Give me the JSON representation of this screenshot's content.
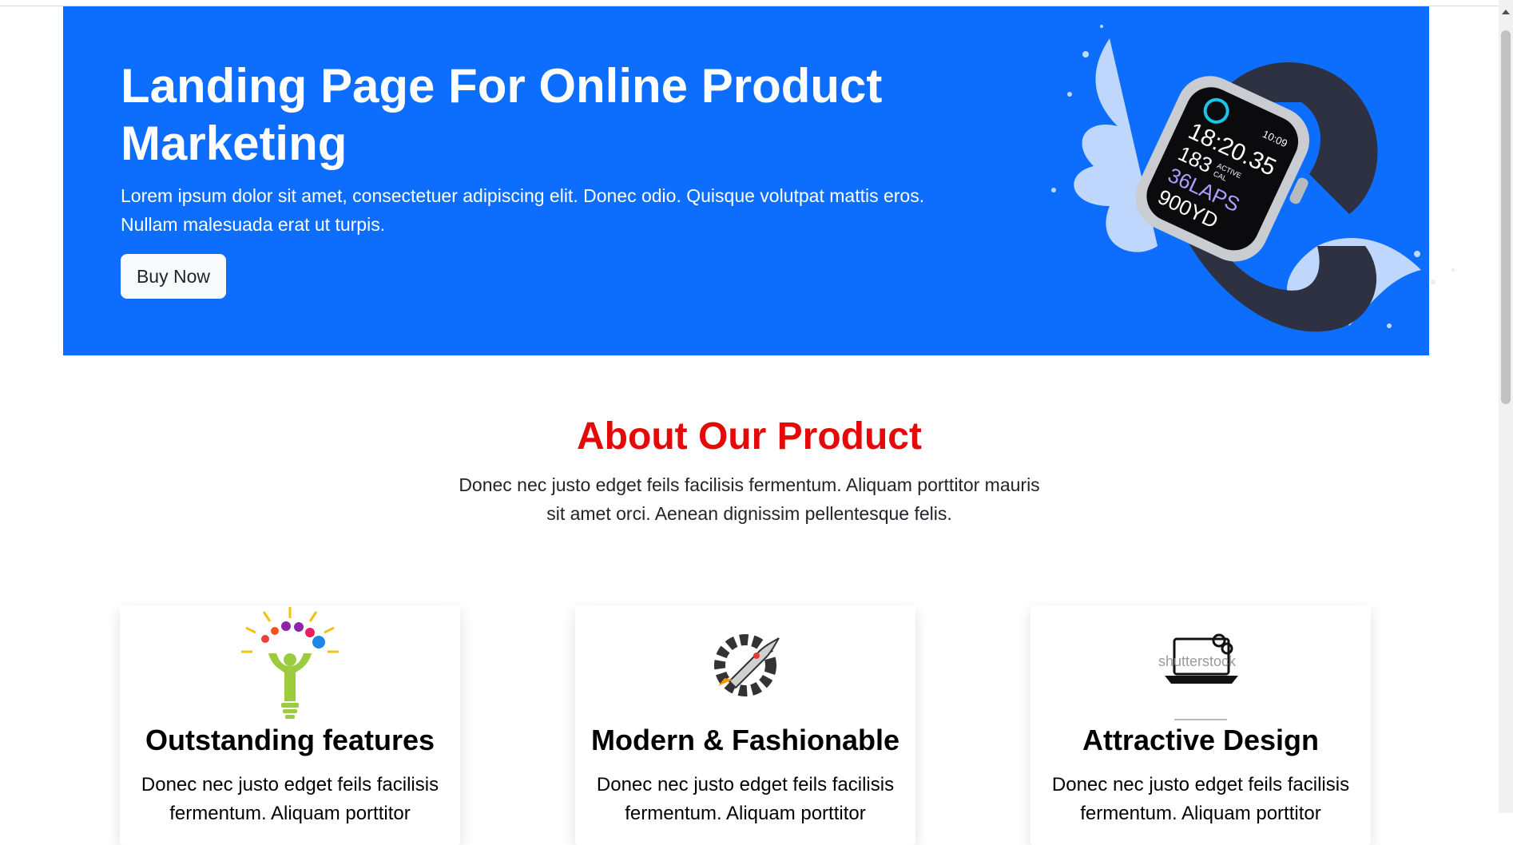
{
  "hero": {
    "title": "Landing Page For Online Product Marketing",
    "text": "Lorem ipsum dolor sit amet, consectetuer adipiscing elit. Donec odio. Quisque volutpat mattis eros. Nullam malesuada erat ut turpis.",
    "button_label": "Buy Now",
    "background_color": "#0d6efd",
    "watch": {
      "time": "18:20.35",
      "active": "183",
      "active_label_1": "ACTIVE",
      "active_label_2": "CAL",
      "laps": "36LAPS",
      "yards": "900YD",
      "clock": "10:09"
    }
  },
  "about": {
    "title": "About Our Product",
    "text": "Donec nec justo edget feils facilisis fermentum. Aliquam porttitor mauris sit amet orci. Aenean dignissim pellentesque felis.",
    "title_color": "#e40a0a"
  },
  "cards": [
    {
      "icon": "lightbulb-person-icon",
      "title": "Outstanding features",
      "text": "Donec nec justo edget feils facilisis fermentum. Aliquam porttitor"
    },
    {
      "icon": "rocket-gear-icon",
      "title": "Modern & Fashionable",
      "text": "Donec nec justo edget feils facilisis fermentum. Aliquam porttitor"
    },
    {
      "icon": "laptop-gears-icon",
      "icon_watermark": "shutterstock",
      "title": "Attractive Design",
      "text": "Donec nec justo edget feils facilisis fermentum. Aliquam porttitor"
    }
  ]
}
